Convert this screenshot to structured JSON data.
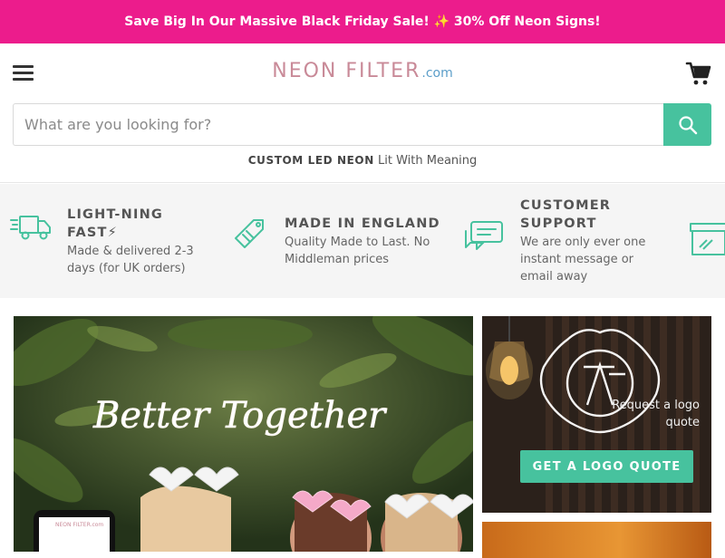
{
  "announcement": {
    "text": "Save Big In Our Massive Black Friday Sale! ✨ 30% Off Neon Signs!"
  },
  "header": {
    "logo_main": "NEON FILTER",
    "logo_tld": ".com",
    "menu_icon": "hamburger-menu-icon",
    "cart_icon": "shopping-cart-icon"
  },
  "search": {
    "placeholder": "What are you looking for?",
    "value": "",
    "button_icon": "search-icon"
  },
  "tagline": {
    "bold": "CUSTOM LED NEON",
    "rest": "Lit With Meaning"
  },
  "features": [
    {
      "icon": "delivery-truck-icon",
      "title_line1": "LIGHT-NING",
      "title_line2": "FAST⚡",
      "desc_line1": "Made & delivered 2-3",
      "desc_line2": "days (for UK orders)",
      "desc_line3": ""
    },
    {
      "icon": "price-tag-icon",
      "title_line1": "MADE IN ENGLAND",
      "title_line2": "",
      "desc_line1": "Quality Made to Last. No",
      "desc_line2": "Middleman prices",
      "desc_line3": ""
    },
    {
      "icon": "chat-bubble-icon",
      "title_line1": "CUSTOMER",
      "title_line2": "SUPPORT",
      "desc_line1": "We are only ever one",
      "desc_line2": "instant message or",
      "desc_line3": "email away"
    }
  ],
  "hero": {
    "neon_text": "Better Together",
    "phone_logo": "NEON FILTER.com"
  },
  "side_card": {
    "alt_text_line1": "Request a logo",
    "alt_text_line2": "quote",
    "button_label": "GET A LOGO QUOTE"
  },
  "colors": {
    "accent": "#47c29e",
    "announcement_bg": "#ec1c8c",
    "features_bg": "#f5f5f5"
  }
}
